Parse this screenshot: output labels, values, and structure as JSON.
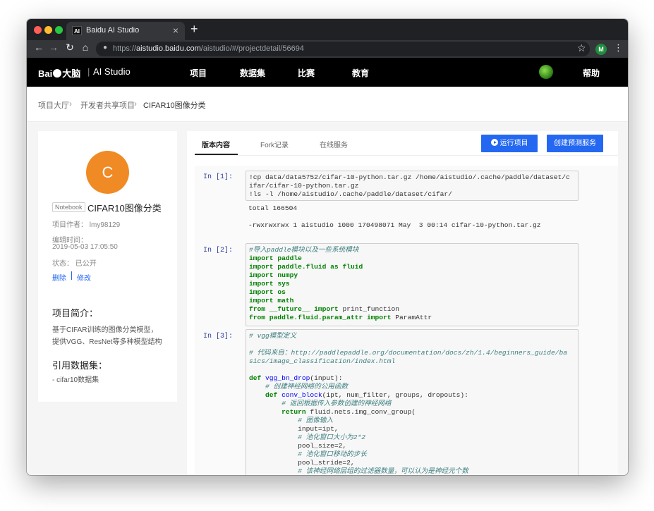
{
  "browser": {
    "tab_favicon": "AI",
    "tab_title": "Baidu AI Studio",
    "tab_close": "×",
    "new_tab": "+",
    "url_scheme": "https://",
    "url_host": "aistudio.baidu.com",
    "url_path": "/aistudio/#/projectdetail/56694",
    "profile_initial": "M",
    "icons": {
      "back": "arrow-left",
      "forward": "arrow-right",
      "reload": "reload",
      "home": "home",
      "lock": "lock",
      "star": "star",
      "menu": "kebab"
    }
  },
  "site": {
    "logo_text": "Bai",
    "logo_suffix": "大脑",
    "logo_sep": "|",
    "logo_sub": "AI Studio",
    "nav": [
      "项目",
      "数据集",
      "比赛",
      "教育"
    ],
    "help": "帮助"
  },
  "breadcrumb": [
    "项目大厅",
    "开发者共享项目",
    "CIFAR10图像分类"
  ],
  "project": {
    "avatar_letter": "C",
    "badge": "Notebook",
    "title": "CIFAR10图像分类",
    "author": "项目作者：  lmy98129",
    "edit_label": "编辑时间：",
    "edit_time": "2019-05-03 17:05:50",
    "status": "状态：  已公开",
    "delete": "删除",
    "edit": "修改",
    "intro_title": "项目简介：",
    "intro_lines": [
      "基于CIFAR训练的图像分类模型，",
      "提供VGG、ResNet等多种模型结构"
    ],
    "datasets_title": "引用数据集：",
    "datasets": [
      "- cifar10数据集"
    ]
  },
  "main": {
    "tabs": [
      "版本内容",
      "Fork记录",
      "在线服务"
    ],
    "run_button": "运行项目",
    "deploy_button": "创建预测服务"
  },
  "cells": {
    "c1": {
      "prompt": "In [1]:",
      "code": [
        "!cp data/data5752/cifar-10-python.tar.gz /home/aistudio/.cache/paddle/dataset/c",
        "ifar/cifar-10-python.tar.gz",
        "!ls -l /home/aistudio/.cache/paddle/dataset/cifar/"
      ],
      "output": [
        "total 166504",
        "-rwxrwxrwx 1 aistudio 1000 170498071 May  3 00:14 cifar-10-python.tar.gz"
      ]
    },
    "c2": {
      "prompt": "In [2]:",
      "comment": "#导入paddle模块以及一些系统模块",
      "import_kw": "import",
      "from_kw": "from",
      "as_kw": "as",
      "modules": [
        "paddle",
        "paddle.fluid",
        "numpy",
        "sys",
        "os",
        "math"
      ],
      "fluid_alias": "fluid",
      "future_mod": "__future__",
      "future_name": "print_function",
      "param_mod": "paddle.fluid.param_attr",
      "param_name": "ParamAttr"
    },
    "c3": {
      "prompt": "In [3]:",
      "comment1": "# vgg模型定义",
      "comment2a": "# 代码来自：http://paddlepaddle.org/documentation/docs/zh/1.4/beginners_guide/ba",
      "comment2b": "sics/image_classification/index.html",
      "def_kw": "def",
      "return_kw": "return",
      "f1_name": "vgg_bn_drop",
      "f1_args": "(input):",
      "c_a": "# 创建神经网络的公用函数",
      "f2_name": "conv_block",
      "f2_args": "(ipt, num_filter, groups, dropouts):",
      "c_b": "# 返回根据传入参数创建的神经网络",
      "ret_expr": "fluid.nets.img_conv_group(",
      "c_c": "# 图像输入",
      "l_input": "input=ipt,",
      "c_d": "# 池化窗口大小为2*2",
      "l_pool_size": "pool_size=2,",
      "c_e": "# 池化窗口移动的步长",
      "l_pool_stride": "pool_stride=2,",
      "c_f": "# 该神经网络层组的过滤器数量，可以认为是神经元个数"
    }
  }
}
